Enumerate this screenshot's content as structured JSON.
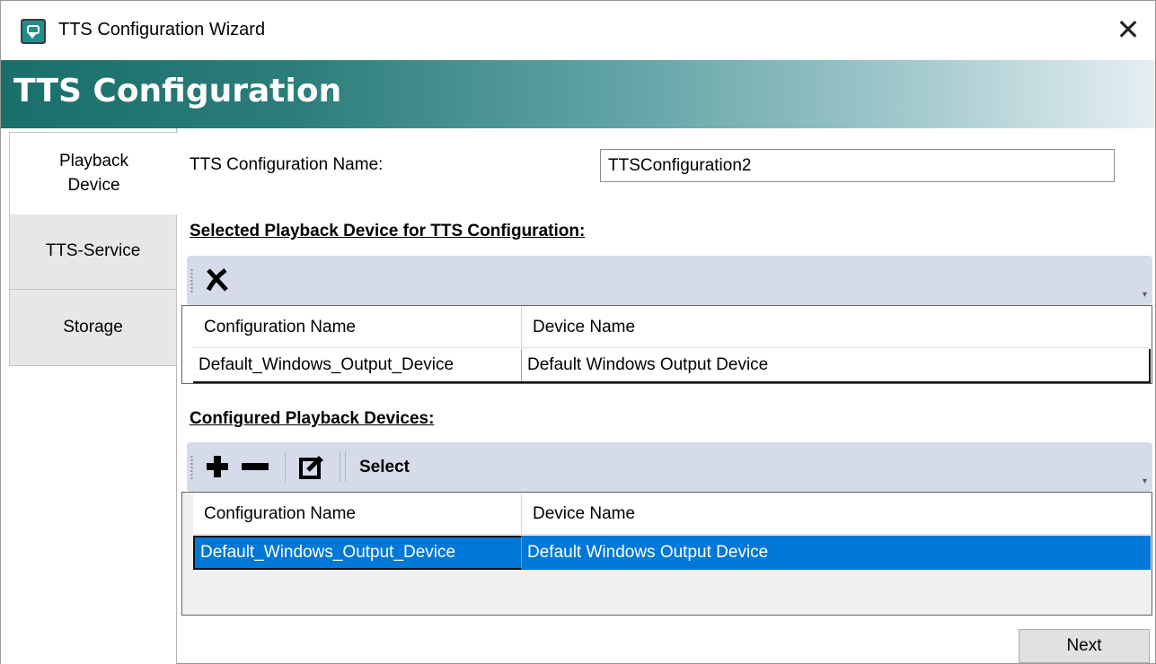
{
  "window": {
    "title": "TTS Configuration Wizard",
    "close_glyph": "✕"
  },
  "banner": {
    "title": "TTS Configuration"
  },
  "tabs": [
    {
      "label": "Playback\nDevice",
      "label_line1": "Playback",
      "label_line2": "Device",
      "active": true
    },
    {
      "label": "TTS-Service",
      "active": false
    },
    {
      "label": "Storage",
      "active": false
    }
  ],
  "form": {
    "name_label": "TTS Configuration Name:",
    "name_value": "TTSConfiguration2"
  },
  "selected_section": {
    "title": "Selected Playback Device for TTS Configuration:",
    "toolbar_icons": [
      "remove-x-icon"
    ],
    "columns": [
      "Configuration Name",
      "Device Name"
    ],
    "rows": [
      [
        "Default_Windows_Output_Device",
        "Default Windows Output Device"
      ]
    ]
  },
  "configured_section": {
    "title": "Configured Playback Devices:",
    "toolbar_icons": [
      "add-icon",
      "remove-icon",
      "edit-icon"
    ],
    "select_label": "Select",
    "columns": [
      "Configuration Name",
      "Device Name"
    ],
    "rows": [
      [
        "Default_Windows_Output_Device",
        "Default Windows Output Device"
      ]
    ],
    "selected_row": 0
  },
  "footer": {
    "next_label": "Next"
  },
  "colors": {
    "banner_start": "#1a6f6b",
    "banner_end": "#e6eff2",
    "toolbar_bg": "#d6dbe9",
    "selection": "#0078d7"
  }
}
